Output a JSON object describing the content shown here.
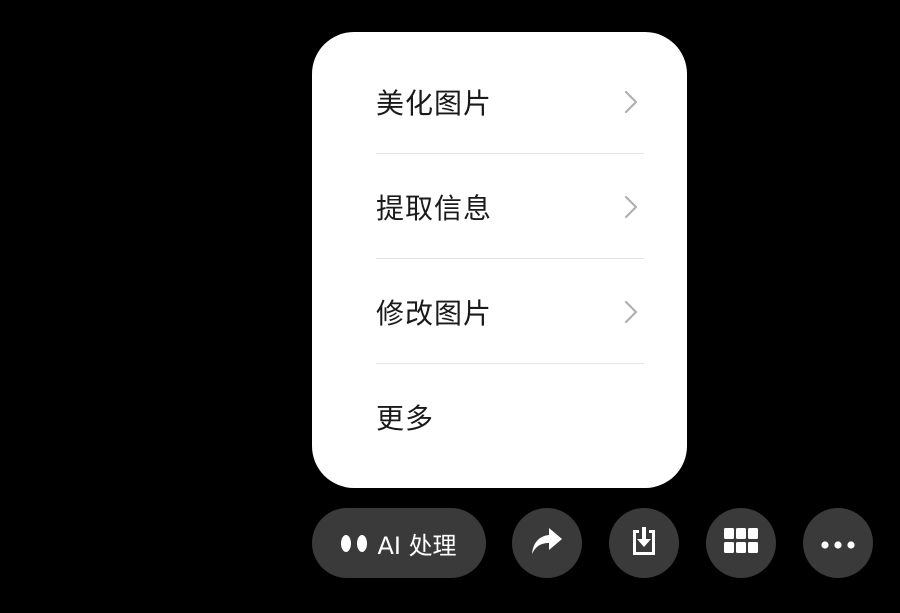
{
  "menu": {
    "items": [
      {
        "label": "美化图片",
        "icon": "chevron-right-icon"
      },
      {
        "label": "提取信息",
        "icon": "chevron-right-icon"
      },
      {
        "label": "修改图片",
        "icon": "chevron-right-icon"
      },
      {
        "label": "更多"
      }
    ]
  },
  "toolbar": {
    "ai_label": "AI 处理",
    "ai_icon": "ai-dots-icon",
    "share_icon": "share-arrow-icon",
    "save_icon": "download-icon",
    "grid_icon": "grid-icon",
    "more_icon": "more-dots-icon"
  },
  "colors": {
    "background": "#000000",
    "menu_background": "#ffffff",
    "button_background": "#3a3a3a",
    "chevron": "#b0b0b0",
    "text_dark": "#1a1a1a",
    "text_light": "#ffffff"
  }
}
